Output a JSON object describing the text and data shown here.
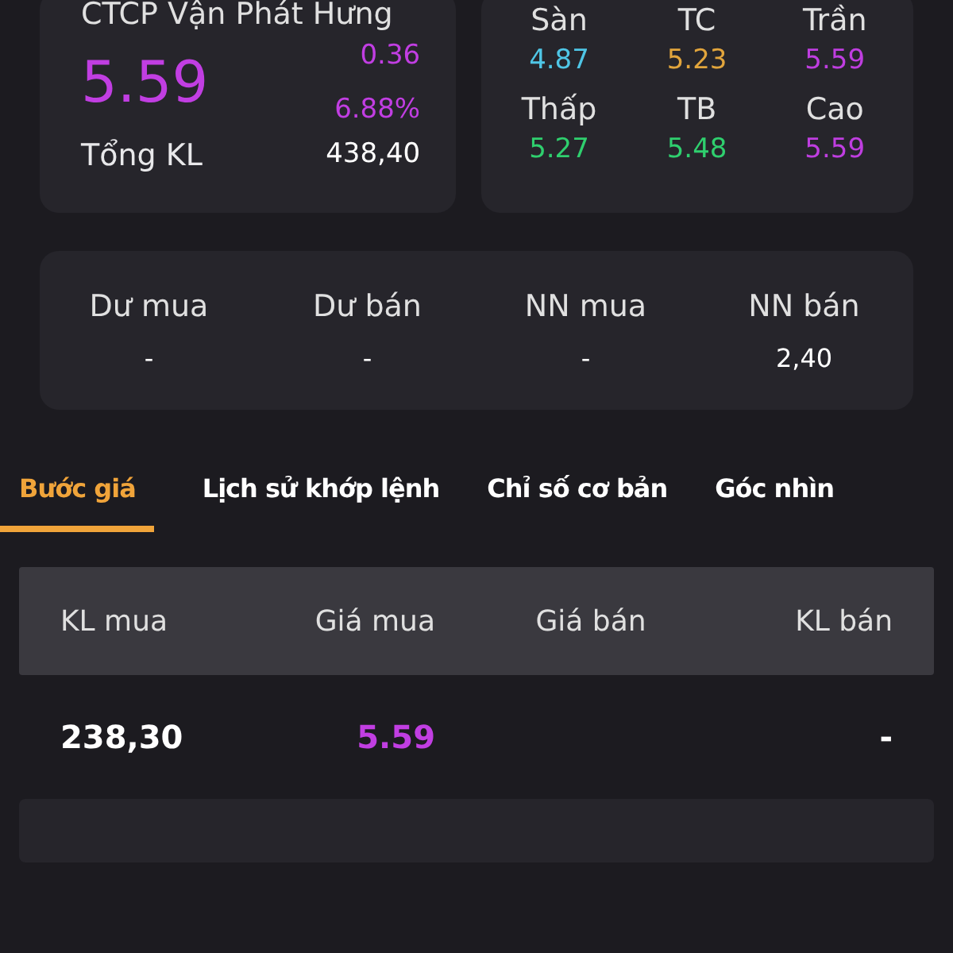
{
  "stock": {
    "name": "CTCP Vận Phát Hưng",
    "price": "5.59",
    "change": "0.36",
    "change_pct": "6.88%",
    "total_label": "Tổng KL",
    "total_value": "438,40"
  },
  "price_levels": [
    {
      "label": "Sàn",
      "value": "4.87",
      "color": "#4fc6e6"
    },
    {
      "label": "TC",
      "value": "5.23",
      "color": "#e2a53c"
    },
    {
      "label": "Trần",
      "value": "5.59",
      "color": "#bf3ee0"
    },
    {
      "label": "Thấp",
      "value": "5.27",
      "color": "#2fcf6e"
    },
    {
      "label": "TB",
      "value": "5.48",
      "color": "#2fcf6e"
    },
    {
      "label": "Cao",
      "value": "5.59",
      "color": "#bf3ee0"
    }
  ],
  "balances": [
    {
      "label": "Dư mua",
      "value": "-"
    },
    {
      "label": "Dư bán",
      "value": "-"
    },
    {
      "label": "NN mua",
      "value": "-"
    },
    {
      "label": "NN bán",
      "value": "2,40"
    }
  ],
  "tabs": [
    {
      "label": "Bước giá",
      "selected": true
    },
    {
      "label": "Lịch sử khớp lệnh",
      "selected": false
    },
    {
      "label": "Chỉ số cơ bản",
      "selected": false
    },
    {
      "label": "Góc nhìn",
      "selected": false
    }
  ],
  "order_book": {
    "columns": [
      "KL mua",
      "Giá mua",
      "Giá bán",
      "KL bán"
    ],
    "rows": [
      {
        "buy_volume": "238,30",
        "buy_price": "5.59",
        "sell_volume": "-"
      }
    ]
  }
}
